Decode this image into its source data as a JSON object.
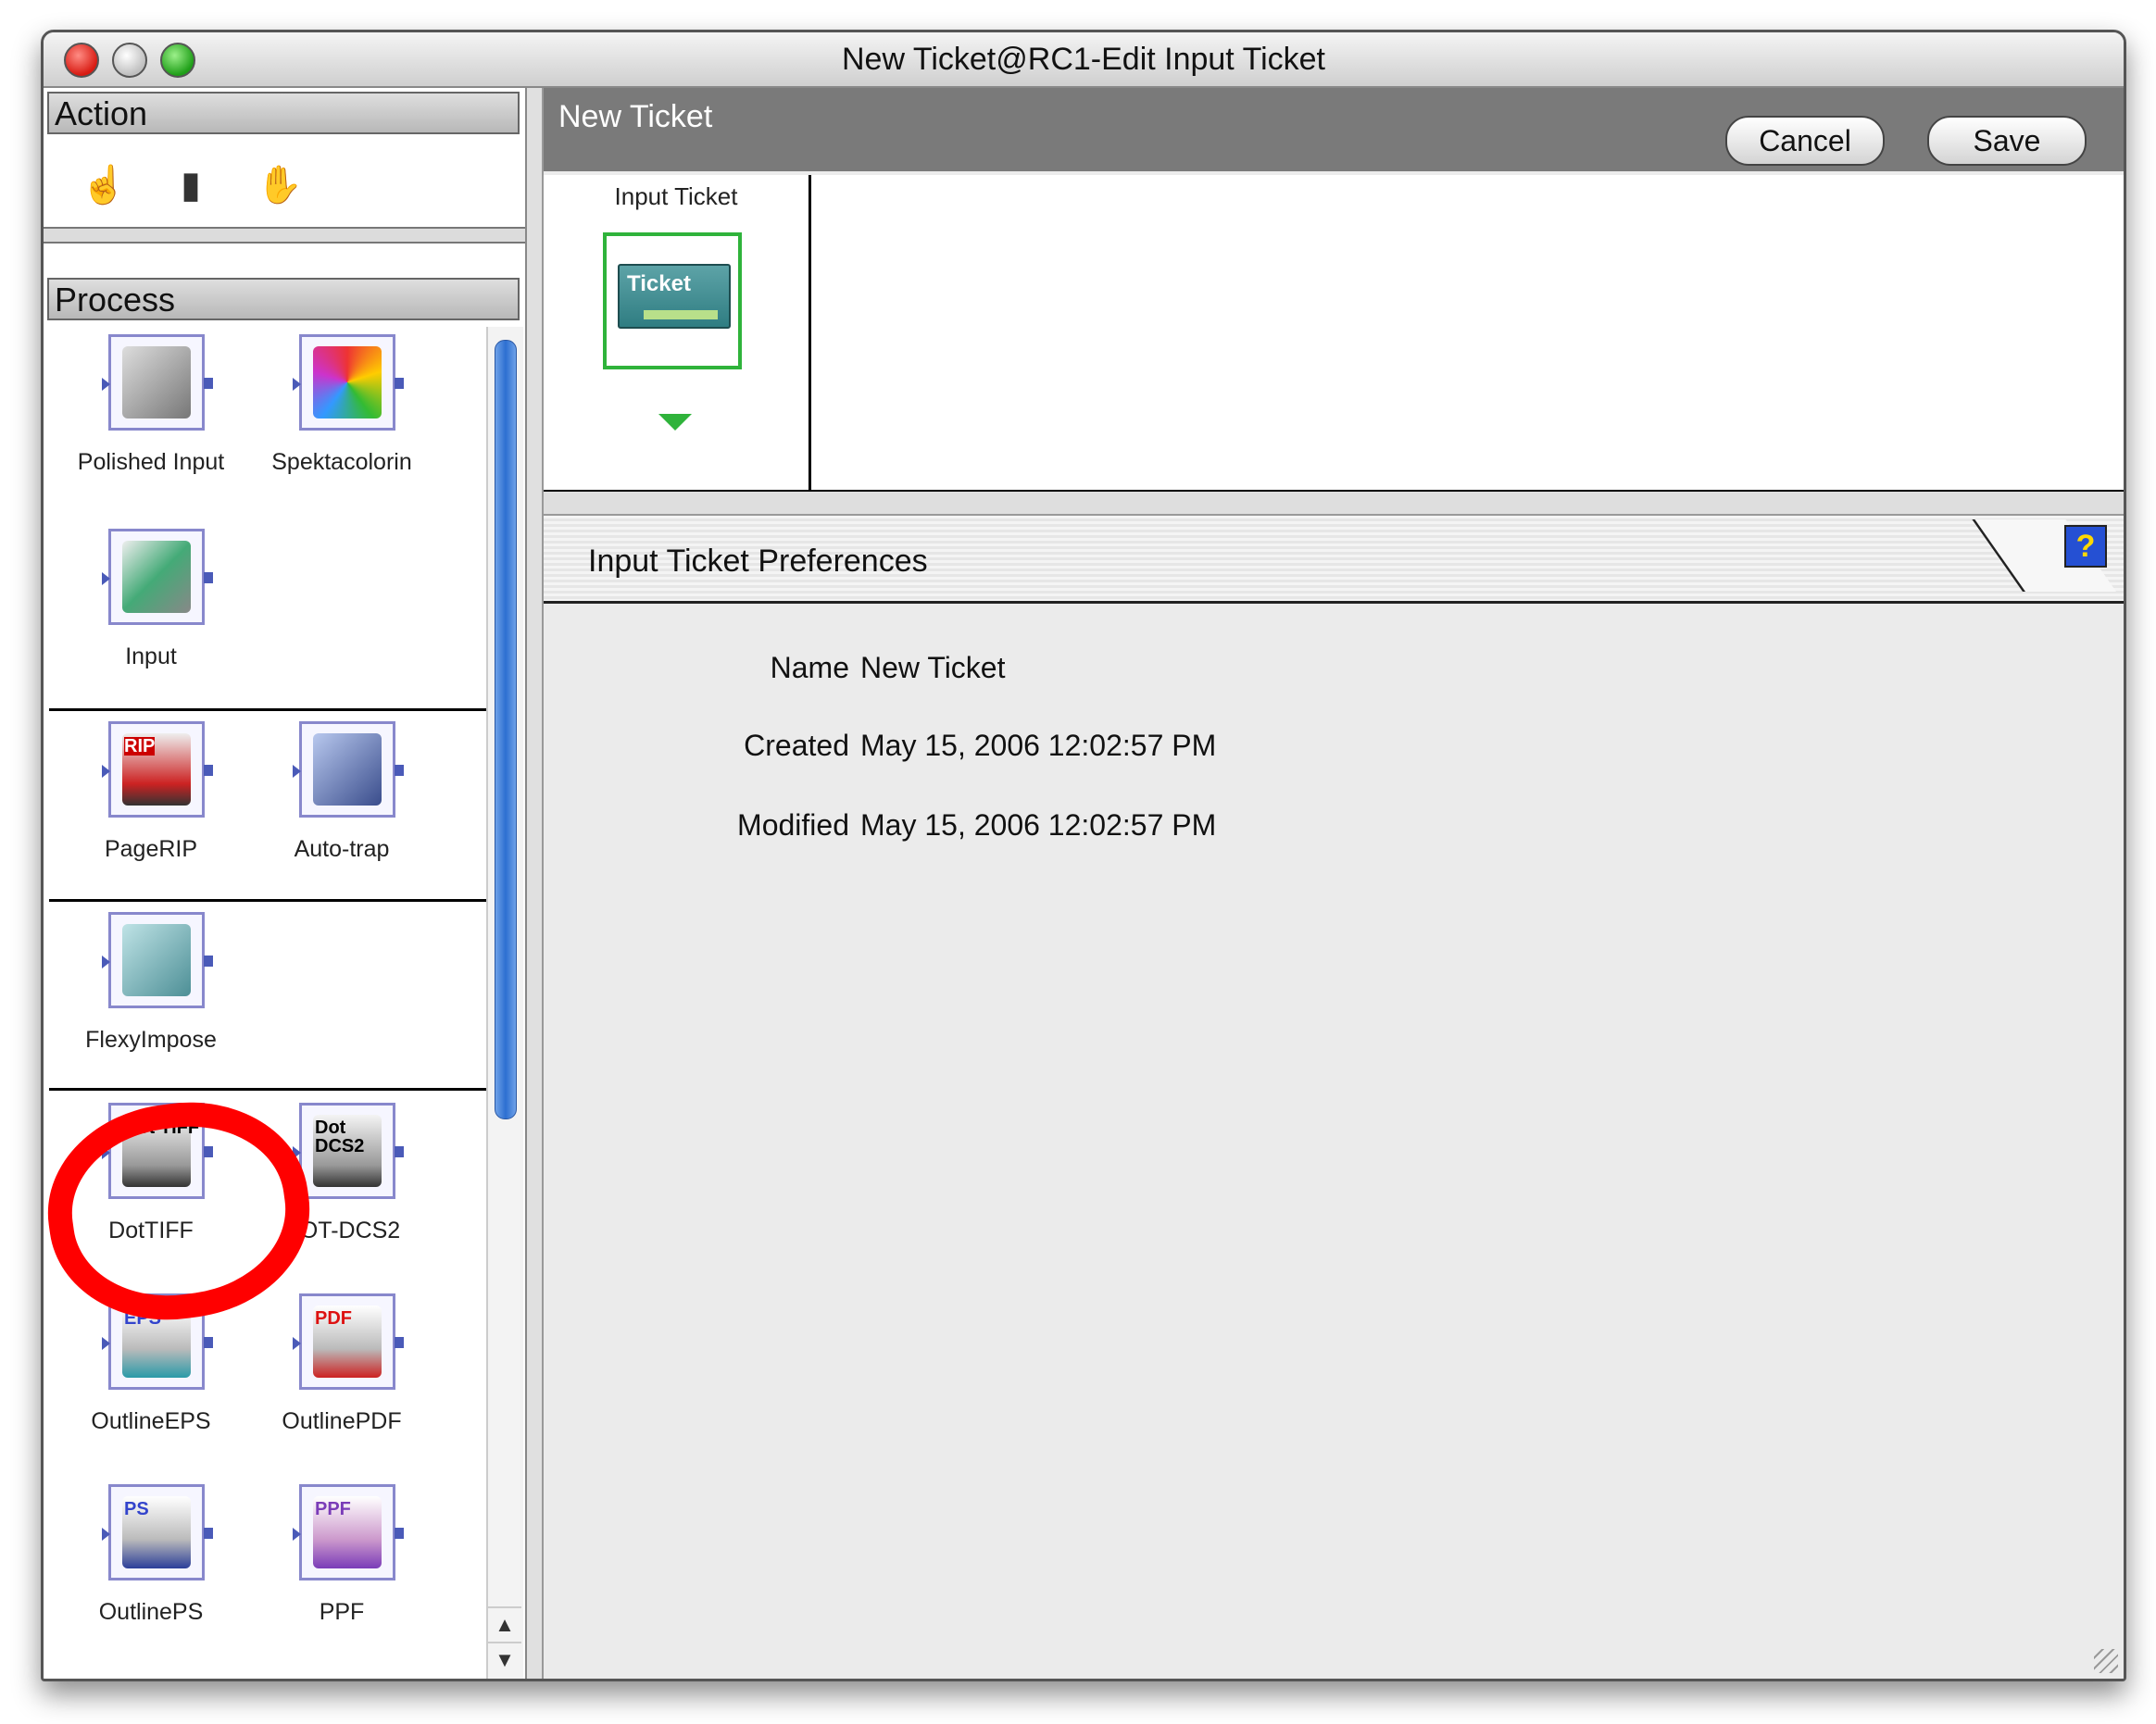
{
  "window": {
    "title": "New Ticket@RC1-Edit Input Ticket"
  },
  "left_panel": {
    "action": {
      "header": "Action",
      "icons": [
        "hand-point-icon",
        "toolbox-icon",
        "hand-stop-icon"
      ]
    },
    "process": {
      "header": "Process",
      "groups": [
        [
          {
            "label": "Polished Input",
            "icon": "polished-input-icon"
          },
          {
            "label": "Spektacolorin",
            "icon": "spektacolorin-icon"
          }
        ],
        [
          {
            "label": "Input",
            "icon": "input-icon"
          }
        ],
        [
          {
            "label": "PageRIP",
            "icon": "pagerip-icon",
            "tag": "RIP"
          },
          {
            "label": "Auto-trap",
            "icon": "auto-trap-icon"
          }
        ],
        [
          {
            "label": "FlexyImpose",
            "icon": "flexyimpose-icon"
          }
        ],
        [
          {
            "label": "DotTIFF",
            "icon": "dottiff-icon",
            "tag": "Dot TIFF"
          },
          {
            "label": "DOT-DCS2",
            "icon": "dot-dcs2-icon",
            "tag": "Dot DCS2"
          }
        ],
        [
          {
            "label": "OutlineEPS",
            "icon": "outline-eps-icon",
            "tag": "EPS"
          },
          {
            "label": "OutlinePDF",
            "icon": "outline-pdf-icon",
            "tag": "PDF"
          }
        ],
        [
          {
            "label": "OutlinePS",
            "icon": "outline-ps-icon",
            "tag": "PS"
          },
          {
            "label": "PPF",
            "icon": "ppf-icon",
            "tag": "PPF"
          }
        ]
      ]
    }
  },
  "ticket_bar": {
    "title": "New Ticket",
    "cancel_label": "Cancel",
    "save_label": "Save"
  },
  "flow": {
    "column_label": "Input Ticket",
    "ticket_card_label": "Ticket"
  },
  "preferences": {
    "title": "Input Ticket Preferences",
    "help_label": "?",
    "fields": [
      {
        "label": "Name",
        "value": "New Ticket"
      },
      {
        "label": "Created",
        "value": "May 15, 2006 12:02:57 PM"
      },
      {
        "label": "Modified",
        "value": "May 15, 2006 12:02:57 PM"
      }
    ]
  },
  "colors": {
    "highlight": "#ff0000",
    "ticket_border": "#2fb33b",
    "scroll_thumb": "#2d6fd1"
  }
}
